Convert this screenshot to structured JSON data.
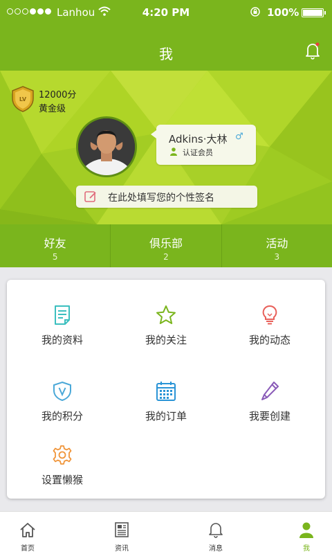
{
  "status_bar": {
    "carrier": "Lanhou",
    "time": "4:20 PM",
    "battery": "100%",
    "signal_bars_filled": 5,
    "signal_bars_total": 9
  },
  "nav": {
    "title": "我",
    "notification_icon": "bell-icon"
  },
  "profile": {
    "points": "12000分",
    "level": "黄金级",
    "name": "Adkins·大林",
    "gender": "♂",
    "member_label": "认证会员",
    "signature_placeholder": "在此处填写您的个性签名"
  },
  "stats": [
    {
      "label": "好友",
      "count": "5"
    },
    {
      "label": "俱乐部",
      "count": "2"
    },
    {
      "label": "活动",
      "count": "3"
    }
  ],
  "menu": [
    {
      "label": "我的资料",
      "icon": "document-icon",
      "color": "#3bbfbf"
    },
    {
      "label": "我的关注",
      "icon": "star-icon",
      "color": "#7ab51d"
    },
    {
      "label": "我的动态",
      "icon": "lightbulb-icon",
      "color": "#e8605a"
    },
    {
      "label": "我的积分",
      "icon": "shield-v-icon",
      "color": "#4aa8d8"
    },
    {
      "label": "我的订单",
      "icon": "calendar-icon",
      "color": "#2a94d6"
    },
    {
      "label": "我要创建",
      "icon": "pencil-icon",
      "color": "#8a5bb8"
    },
    {
      "label": "设置懒猴",
      "icon": "gear-icon",
      "color": "#f0953a"
    }
  ],
  "tabs": [
    {
      "label": "首页",
      "icon": "home-icon"
    },
    {
      "label": "资讯",
      "icon": "news-icon"
    },
    {
      "label": "消息",
      "icon": "bell-icon"
    },
    {
      "label": "我",
      "icon": "person-icon"
    }
  ],
  "colors": {
    "brand_green": "#7ab51d",
    "gender_blue": "#4aa8d8"
  }
}
